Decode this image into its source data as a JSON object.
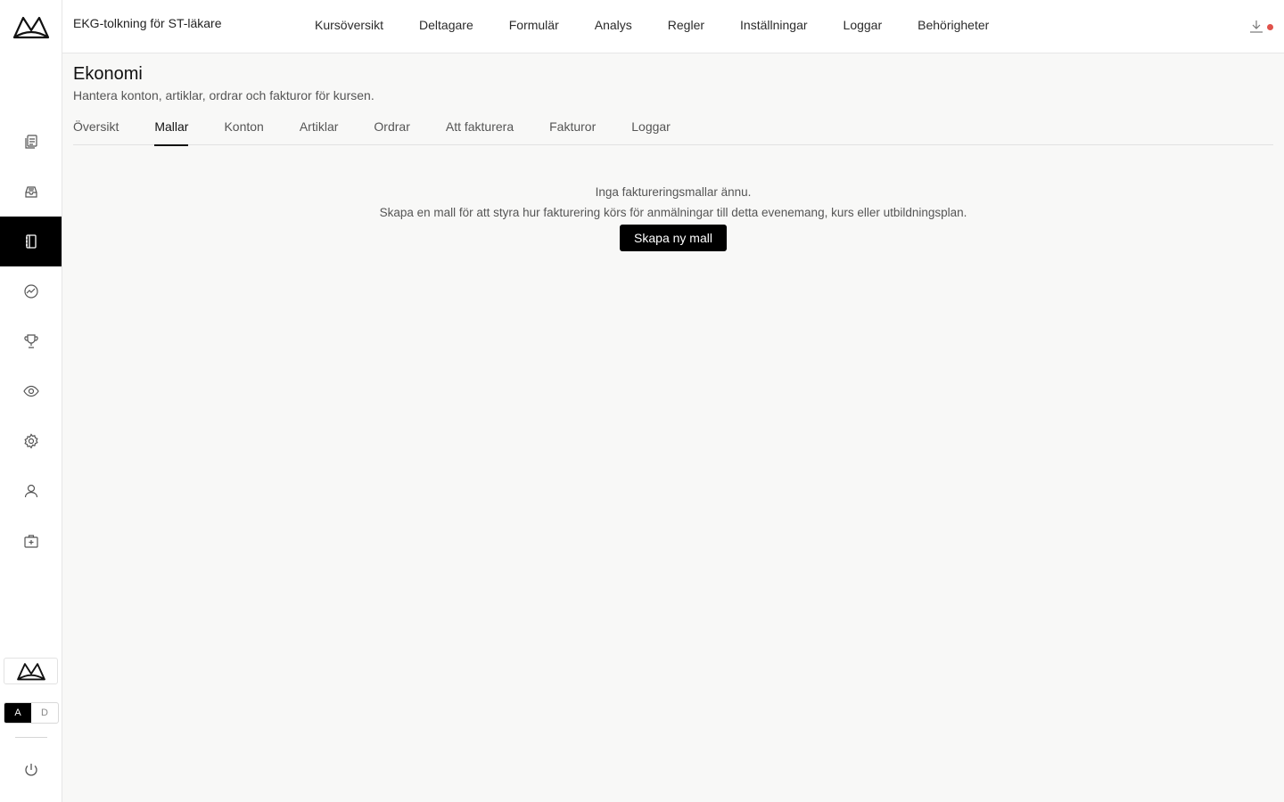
{
  "app": {
    "course_title": "EKG-tolkning för ST-läkare"
  },
  "topnav": {
    "items": [
      "Kursöversikt",
      "Deltagare",
      "Formulär",
      "Analys",
      "Regler",
      "Inställningar",
      "Loggar",
      "Behörigheter"
    ]
  },
  "sidebar": {
    "items": [
      {
        "icon": "documents-icon",
        "active": false
      },
      {
        "icon": "inbox-icon",
        "active": false
      },
      {
        "icon": "ledger-icon",
        "active": true
      },
      {
        "icon": "analytics-icon",
        "active": false
      },
      {
        "icon": "trophy-icon",
        "active": false
      },
      {
        "icon": "eye-icon",
        "active": false
      },
      {
        "icon": "gear-icon",
        "active": false
      },
      {
        "icon": "user-icon",
        "active": false
      },
      {
        "icon": "medical-kit-icon",
        "active": false
      }
    ],
    "toggle": {
      "a": "A",
      "d": "D",
      "selected": "A"
    }
  },
  "page": {
    "title": "Ekonomi",
    "subtitle": "Hantera konton, artiklar, ordrar och fakturor för kursen.",
    "tabs": [
      "Översikt",
      "Mallar",
      "Konton",
      "Artiklar",
      "Ordrar",
      "Att fakturera",
      "Fakturor",
      "Loggar"
    ],
    "active_tab": "Mallar"
  },
  "empty_state": {
    "title": "Inga faktureringsmallar ännu.",
    "description": "Skapa en mall för att styra hur fakturering körs för anmälningar till detta evenemang, kurs eller utbildningsplan.",
    "button_label": "Skapa ny mall"
  },
  "colors": {
    "accent": "#000000",
    "notification": "#e0524b",
    "background": "#f8f8f7"
  }
}
